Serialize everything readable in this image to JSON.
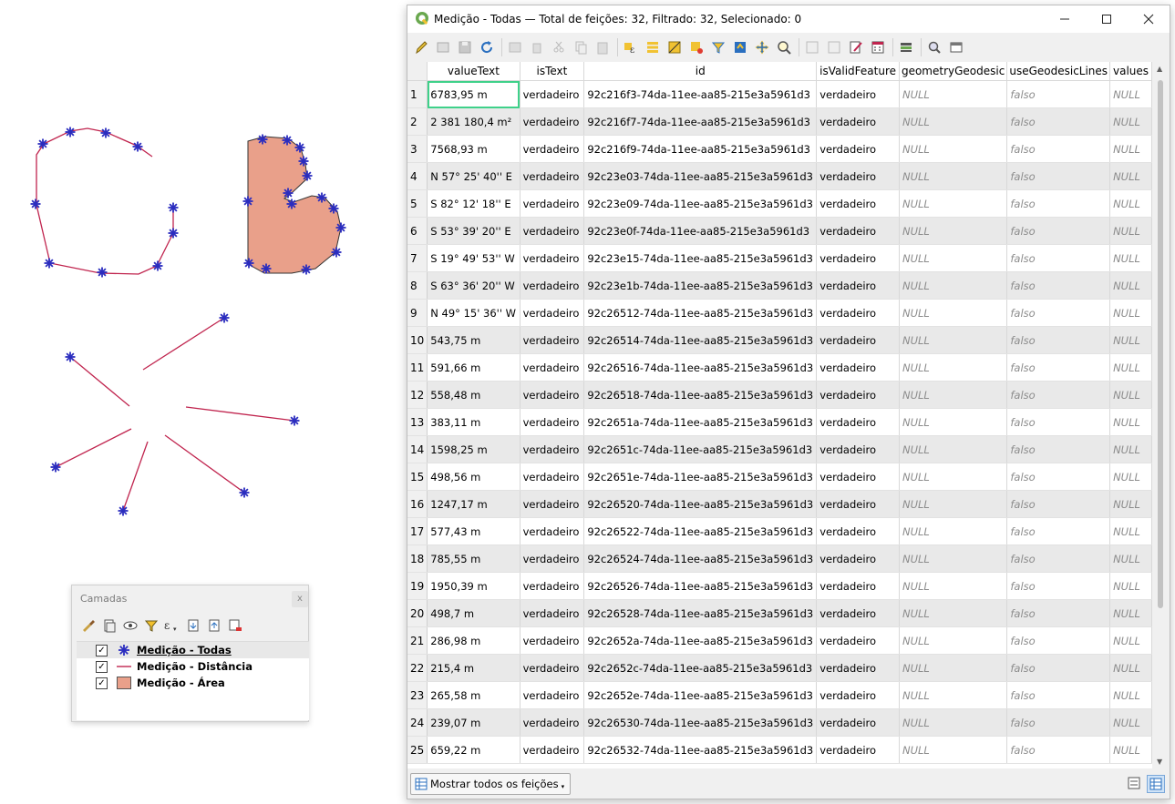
{
  "window": {
    "title": "Medição - Todas — Total de feições: 32, Filtrado: 32, Selecionado: 0"
  },
  "columns": [
    "valueText",
    "isText",
    "id",
    "isValidFeature",
    "geometryGeodesic",
    "useGeodesicLines",
    "values"
  ],
  "rows": [
    [
      "1",
      "6783,95 m",
      "verdadeiro",
      "92c216f3-74da-11ee-aa85-215e3a5961d3",
      "verdadeiro",
      "NULL",
      "falso",
      "NULL"
    ],
    [
      "2",
      "2 381 180,4 m²",
      "verdadeiro",
      "92c216f7-74da-11ee-aa85-215e3a5961d3",
      "verdadeiro",
      "NULL",
      "falso",
      "NULL"
    ],
    [
      "3",
      "7568,93 m",
      "verdadeiro",
      "92c216f9-74da-11ee-aa85-215e3a5961d3",
      "verdadeiro",
      "NULL",
      "falso",
      "NULL"
    ],
    [
      "4",
      "N 57° 25' 40'' E",
      "verdadeiro",
      "92c23e03-74da-11ee-aa85-215e3a5961d3",
      "verdadeiro",
      "NULL",
      "falso",
      "NULL"
    ],
    [
      "5",
      "S 82° 12' 18'' E",
      "verdadeiro",
      "92c23e09-74da-11ee-aa85-215e3a5961d3",
      "verdadeiro",
      "NULL",
      "falso",
      "NULL"
    ],
    [
      "6",
      "S 53° 39' 20'' E",
      "verdadeiro",
      "92c23e0f-74da-11ee-aa85-215e3a5961d3",
      "verdadeiro",
      "NULL",
      "falso",
      "NULL"
    ],
    [
      "7",
      "S 19° 49' 53'' W",
      "verdadeiro",
      "92c23e15-74da-11ee-aa85-215e3a5961d3",
      "verdadeiro",
      "NULL",
      "falso",
      "NULL"
    ],
    [
      "8",
      "S 63° 36' 20'' W",
      "verdadeiro",
      "92c23e1b-74da-11ee-aa85-215e3a5961d3",
      "verdadeiro",
      "NULL",
      "falso",
      "NULL"
    ],
    [
      "9",
      "N 49° 15' 36'' W",
      "verdadeiro",
      "92c26512-74da-11ee-aa85-215e3a5961d3",
      "verdadeiro",
      "NULL",
      "falso",
      "NULL"
    ],
    [
      "10",
      "543,75 m",
      "verdadeiro",
      "92c26514-74da-11ee-aa85-215e3a5961d3",
      "verdadeiro",
      "NULL",
      "falso",
      "NULL"
    ],
    [
      "11",
      "591,66 m",
      "verdadeiro",
      "92c26516-74da-11ee-aa85-215e3a5961d3",
      "verdadeiro",
      "NULL",
      "falso",
      "NULL"
    ],
    [
      "12",
      "558,48 m",
      "verdadeiro",
      "92c26518-74da-11ee-aa85-215e3a5961d3",
      "verdadeiro",
      "NULL",
      "falso",
      "NULL"
    ],
    [
      "13",
      "383,11 m",
      "verdadeiro",
      "92c2651a-74da-11ee-aa85-215e3a5961d3",
      "verdadeiro",
      "NULL",
      "falso",
      "NULL"
    ],
    [
      "14",
      "1598,25 m",
      "verdadeiro",
      "92c2651c-74da-11ee-aa85-215e3a5961d3",
      "verdadeiro",
      "NULL",
      "falso",
      "NULL"
    ],
    [
      "15",
      "498,56 m",
      "verdadeiro",
      "92c2651e-74da-11ee-aa85-215e3a5961d3",
      "verdadeiro",
      "NULL",
      "falso",
      "NULL"
    ],
    [
      "16",
      "1247,17 m",
      "verdadeiro",
      "92c26520-74da-11ee-aa85-215e3a5961d3",
      "verdadeiro",
      "NULL",
      "falso",
      "NULL"
    ],
    [
      "17",
      "577,43 m",
      "verdadeiro",
      "92c26522-74da-11ee-aa85-215e3a5961d3",
      "verdadeiro",
      "NULL",
      "falso",
      "NULL"
    ],
    [
      "18",
      "785,55 m",
      "verdadeiro",
      "92c26524-74da-11ee-aa85-215e3a5961d3",
      "verdadeiro",
      "NULL",
      "falso",
      "NULL"
    ],
    [
      "19",
      "1950,39 m",
      "verdadeiro",
      "92c26526-74da-11ee-aa85-215e3a5961d3",
      "verdadeiro",
      "NULL",
      "falso",
      "NULL"
    ],
    [
      "20",
      "498,7 m",
      "verdadeiro",
      "92c26528-74da-11ee-aa85-215e3a5961d3",
      "verdadeiro",
      "NULL",
      "falso",
      "NULL"
    ],
    [
      "21",
      "286,98 m",
      "verdadeiro",
      "92c2652a-74da-11ee-aa85-215e3a5961d3",
      "verdadeiro",
      "NULL",
      "falso",
      "NULL"
    ],
    [
      "22",
      "215,4 m",
      "verdadeiro",
      "92c2652c-74da-11ee-aa85-215e3a5961d3",
      "verdadeiro",
      "NULL",
      "falso",
      "NULL"
    ],
    [
      "23",
      "265,58 m",
      "verdadeiro",
      "92c2652e-74da-11ee-aa85-215e3a5961d3",
      "verdadeiro",
      "NULL",
      "falso",
      "NULL"
    ],
    [
      "24",
      "239,07 m",
      "verdadeiro",
      "92c26530-74da-11ee-aa85-215e3a5961d3",
      "verdadeiro",
      "NULL",
      "falso",
      "NULL"
    ],
    [
      "25",
      "659,22 m",
      "verdadeiro",
      "92c26532-74da-11ee-aa85-215e3a5961d3",
      "verdadeiro",
      "NULL",
      "falso",
      "NULL"
    ]
  ],
  "status": {
    "filter_button": "Mostrar todos os feições"
  },
  "layers_panel": {
    "title": "Camadas",
    "close": "x",
    "items": [
      {
        "name": "Medição - Todas",
        "symbol": "point-star",
        "checked": true,
        "selected": true
      },
      {
        "name": "Medição - Distância",
        "symbol": "line",
        "checked": true,
        "selected": false
      },
      {
        "name": "Medição - Área",
        "symbol": "polygon",
        "checked": true,
        "selected": false
      }
    ]
  },
  "colors": {
    "point": "#2b2dbf",
    "line": "#c0244e",
    "polygon_fill": "#e9a08a",
    "cell_focus": "#3fd18a"
  }
}
